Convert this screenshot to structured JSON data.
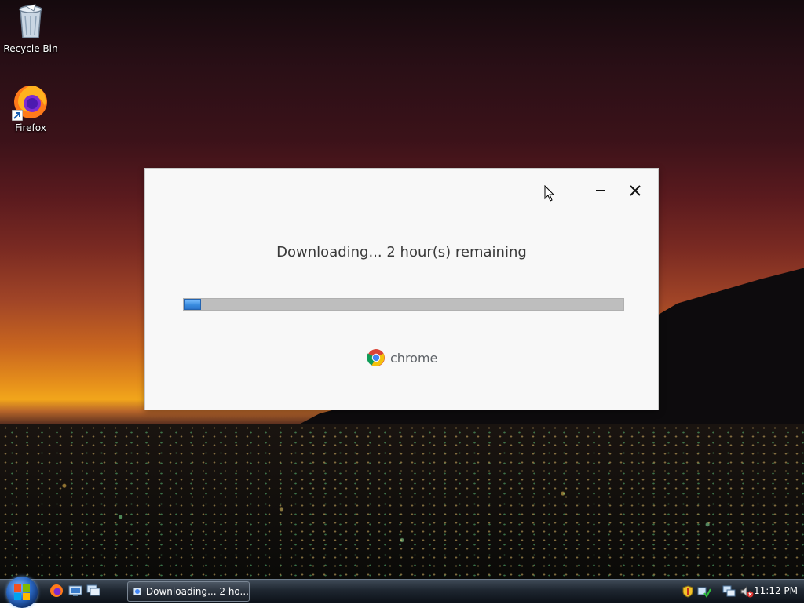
{
  "desktop": {
    "icons": [
      {
        "label": "Recycle Bin",
        "icon": "recycle-bin-icon"
      },
      {
        "label": "Firefox",
        "icon": "firefox-icon"
      }
    ]
  },
  "dialog": {
    "status_text": "Downloading... 2 hour(s) remaining",
    "progress_fraction": 0.04,
    "brand_text": "chrome",
    "minimize_icon": "minimize-icon",
    "close_icon": "close-icon"
  },
  "taskbar": {
    "start_icon": "windows-start-icon",
    "quick_launch": [
      "firefox-icon",
      "show-desktop-icon",
      "switch-windows-icon"
    ],
    "task_button_label": "Downloading... 2 ho...",
    "tray_icons": [
      "security-shield-icon",
      "network-check-icon",
      "network-icon",
      "volume-muted-icon"
    ],
    "clock": "11:12 PM"
  },
  "colors": {
    "progress_fill": "#3a8de0",
    "progress_track": "#bebebe",
    "dialog_bg": "#f8f8f8"
  }
}
